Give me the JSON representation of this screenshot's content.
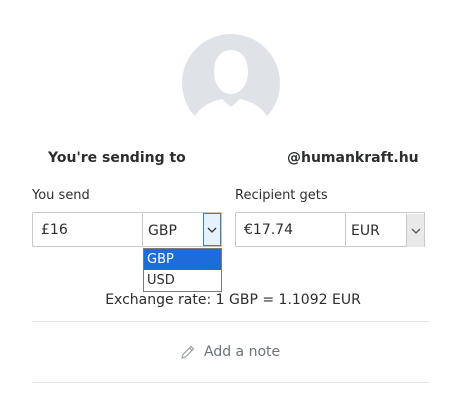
{
  "header": {
    "avatar_icon": "person-silhouette-icon",
    "sending_label": "You're sending to",
    "recipient": "@humankraft.hu"
  },
  "send": {
    "label": "You send",
    "amount": "£16",
    "currency": "GBP",
    "dropdown_icon": "chevron-down-icon",
    "dropdown_open": true,
    "options": [
      "GBP",
      "USD"
    ],
    "selected_option": "GBP"
  },
  "receive": {
    "label": "Recipient gets",
    "amount": "€17.74",
    "currency": "EUR",
    "dropdown_icon": "chevron-down-icon"
  },
  "exchange_rate": "Exchange rate: 1 GBP = 1.1092 EUR",
  "note": {
    "icon": "pencil-icon",
    "label": "Add a note"
  },
  "colors": {
    "avatar_bg": "#dfe3e8",
    "selected_option_bg": "#1e6bdc",
    "divider": "#e1e4e6"
  }
}
